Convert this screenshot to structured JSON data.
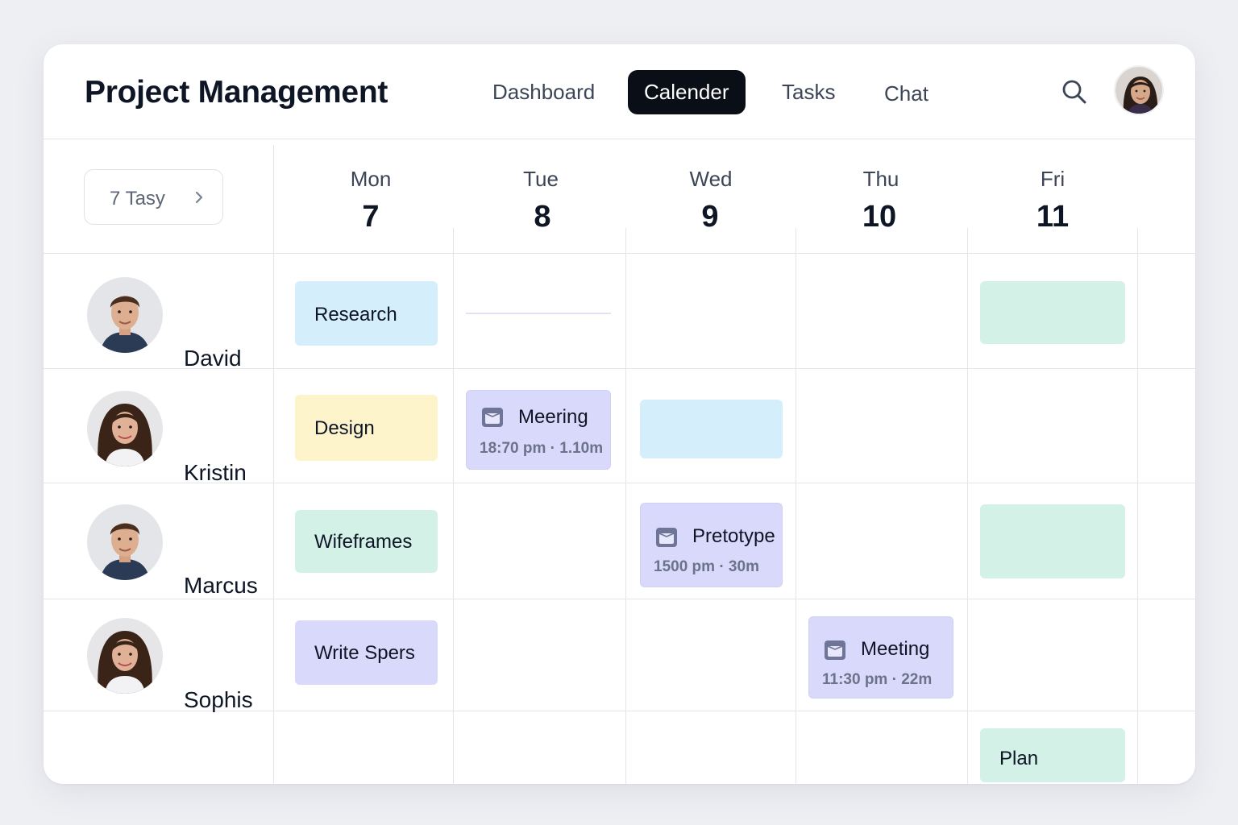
{
  "app": {
    "title": "Project Management"
  },
  "nav": {
    "items": [
      {
        "label": "Dashboard",
        "active": false
      },
      {
        "label": "Calender",
        "active": true
      },
      {
        "label": "Tasks",
        "active": false
      },
      {
        "label": "Chat",
        "active": false
      }
    ]
  },
  "icons": {
    "search": "search-icon",
    "event": "calendar-icon",
    "range_arrow": "chevron-right-icon"
  },
  "range_selector": {
    "label": "7 Tasy"
  },
  "days": [
    {
      "name": "Mon",
      "num": "7"
    },
    {
      "name": "Tue",
      "num": "8"
    },
    {
      "name": "Wed",
      "num": "9"
    },
    {
      "name": "Thu",
      "num": "10"
    },
    {
      "name": "Fri",
      "num": "11"
    }
  ],
  "members": [
    {
      "name": "David"
    },
    {
      "name": "Kristin"
    },
    {
      "name": "Marcus"
    },
    {
      "name": "Sophis"
    }
  ],
  "events": {
    "research": {
      "label": "Research",
      "color": "#d5eefc"
    },
    "design": {
      "label": "Design",
      "color": "#fef4cc"
    },
    "wireframes": {
      "label": "Wifeframes",
      "color": "#d4f1e8"
    },
    "write_specs": {
      "label": "Write Spers",
      "color": "#d9d9fb"
    },
    "meeting_kristin": {
      "title": "Meering",
      "time": "18:70 pm · 1.10m",
      "color": "#d9d9fb"
    },
    "prototype": {
      "title": "Pretotype",
      "time": "1500 pm · 30m",
      "color": "#d9d9fb"
    },
    "meeting_sophis": {
      "title": "Meeting",
      "time": "11:30 pm · 22m",
      "color": "#d9d9fb"
    },
    "plan": {
      "label": "Plan",
      "color": "#d4f1e8"
    },
    "blank_blue": {
      "color": "#d5eefc"
    },
    "blank_green": {
      "color": "#d4f1e8"
    }
  },
  "colors": {
    "nav_active_bg": "#0a0e17",
    "accent_purple": "#d9d9fb",
    "grid_line": "#e3e5ea"
  }
}
